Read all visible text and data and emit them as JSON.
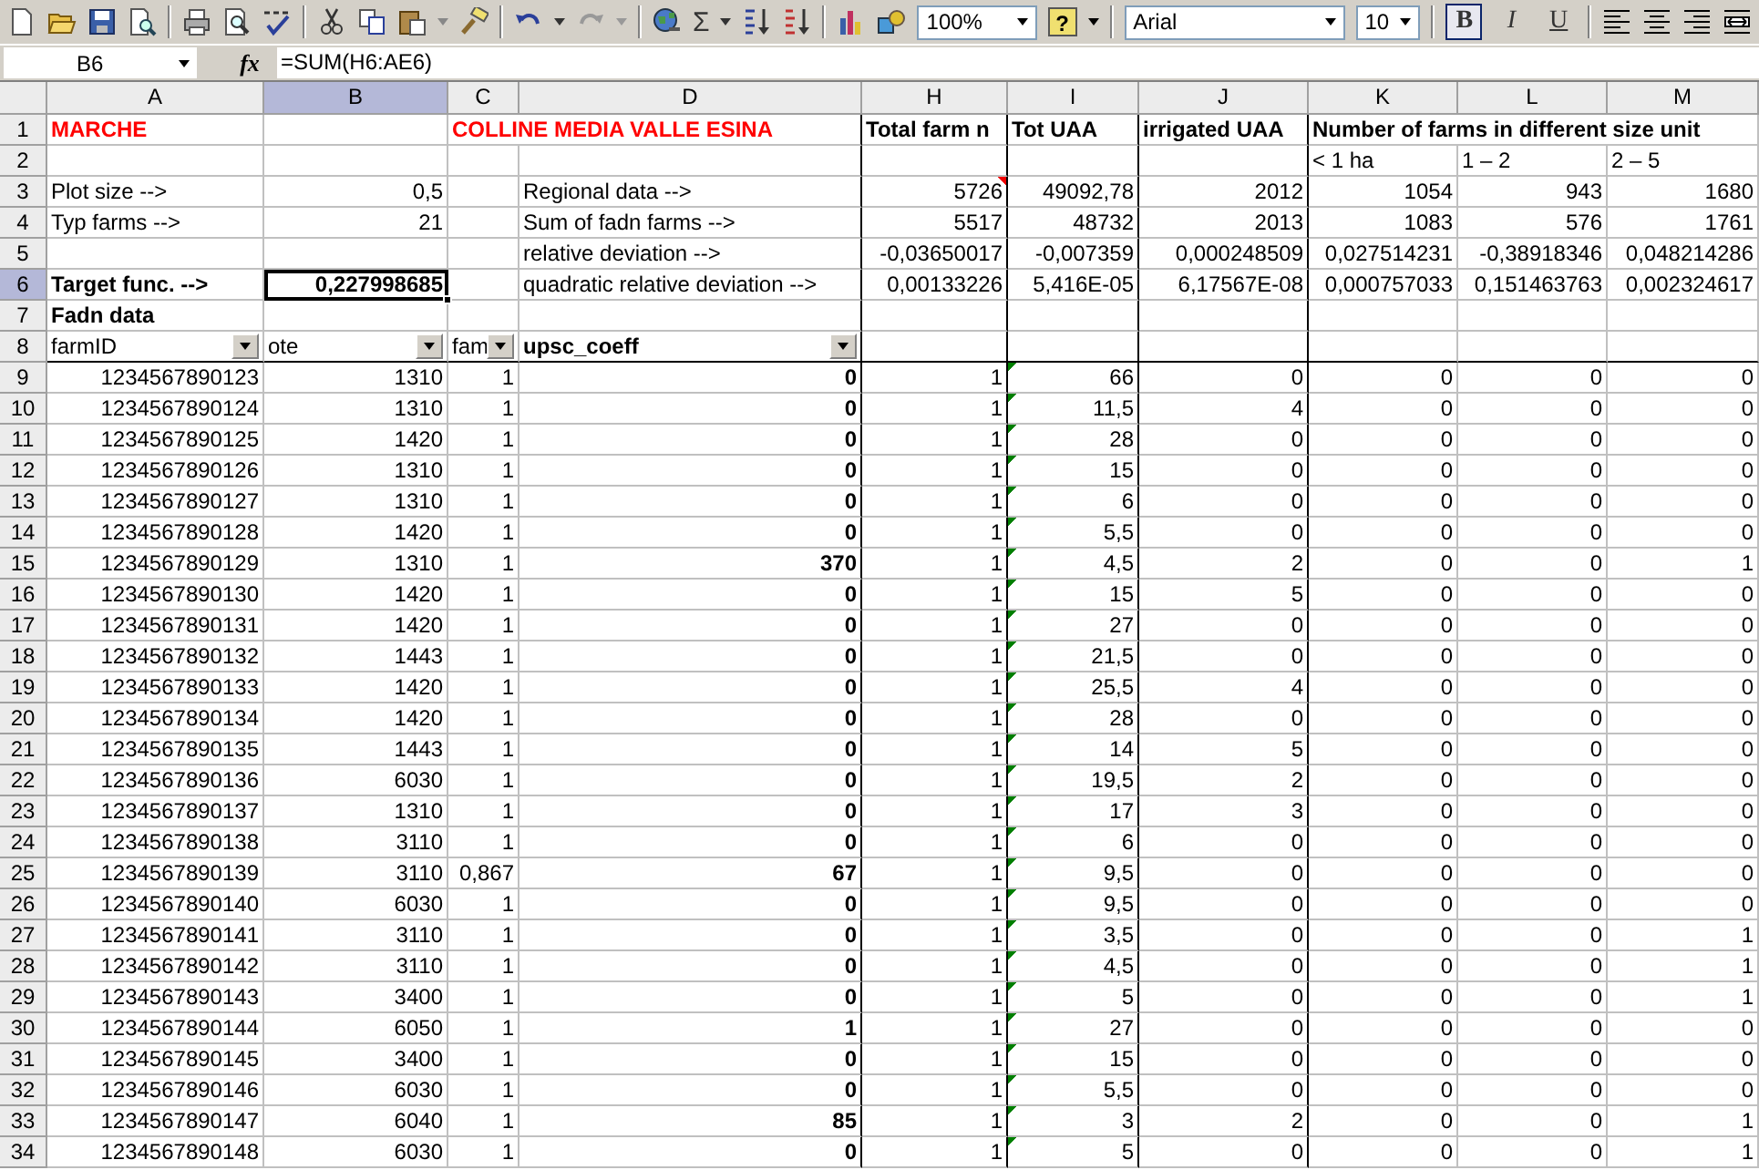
{
  "toolbar": {
    "sum_symbol": "Σ",
    "zoom": "100%",
    "help_symbol": "?",
    "font": "Arial",
    "size": "10",
    "style_buttons": [
      {
        "label": "B",
        "selected": true
      },
      {
        "label": "I",
        "selected": false
      },
      {
        "label": "U",
        "selected": false
      }
    ]
  },
  "formula_bar": {
    "name_box": "B6",
    "fx": "fx",
    "formula": "=SUM(H6:AE6)"
  },
  "columns": [
    {
      "letter": "A",
      "selected": false
    },
    {
      "letter": "B",
      "selected": true
    },
    {
      "letter": "C",
      "selected": false
    },
    {
      "letter": "D",
      "selected": false
    },
    {
      "letter": "H",
      "selected": false
    },
    {
      "letter": "I",
      "selected": false,
      "flagged": true
    },
    {
      "letter": "J",
      "selected": false
    },
    {
      "letter": "K",
      "selected": false
    },
    {
      "letter": "L",
      "selected": false
    },
    {
      "letter": "M",
      "selected": false
    }
  ],
  "rows": [
    {
      "number": "1",
      "selected": false,
      "kind": "form",
      "cells": [
        {
          "kind": "title",
          "text": "MARCHE"
        },
        {
          "kind": "empty"
        },
        {
          "kind": "title-overflow",
          "text": "COLLINE MEDIA VALLE ESINA"
        },
        {
          "kind": "empty"
        },
        {
          "kind": "heading",
          "text": "Total farm n"
        },
        {
          "kind": "heading",
          "text": "Tot UAA"
        },
        {
          "kind": "heading",
          "text": "irrigated UAA"
        },
        {
          "kind": "heading-overflow",
          "text": "Number of farms in different size unit"
        },
        {
          "kind": "empty"
        },
        {
          "kind": "empty"
        }
      ]
    },
    {
      "number": "2",
      "selected": false,
      "kind": "form",
      "cells": [
        {
          "kind": "empty"
        },
        {
          "kind": "empty"
        },
        {
          "kind": "empty"
        },
        {
          "kind": "empty"
        },
        {
          "kind": "empty"
        },
        {
          "kind": "empty"
        },
        {
          "kind": "empty"
        },
        {
          "kind": "label",
          "text": "< 1 ha"
        },
        {
          "kind": "label",
          "text": "1 – 2"
        },
        {
          "kind": "label",
          "text": "2 – 5"
        }
      ]
    },
    {
      "number": "3",
      "selected": false,
      "kind": "form",
      "cells": [
        {
          "kind": "label",
          "text": "Plot size -->"
        },
        {
          "kind": "number",
          "text": "0,5"
        },
        {
          "kind": "empty"
        },
        {
          "kind": "label",
          "text": "Regional data -->"
        },
        {
          "kind": "number",
          "text": "5726",
          "comment": true
        },
        {
          "kind": "number",
          "text": "49092,78"
        },
        {
          "kind": "number",
          "text": "2012"
        },
        {
          "kind": "number",
          "text": "1054"
        },
        {
          "kind": "number",
          "text": "943"
        },
        {
          "kind": "number",
          "text": "1680"
        }
      ]
    },
    {
      "number": "4",
      "selected": false,
      "kind": "form",
      "cells": [
        {
          "kind": "label",
          "text": "Typ farms -->"
        },
        {
          "kind": "number",
          "text": "21"
        },
        {
          "kind": "empty"
        },
        {
          "kind": "label",
          "text": "Sum of fadn farms -->"
        },
        {
          "kind": "number",
          "text": "5517"
        },
        {
          "kind": "number",
          "text": "48732"
        },
        {
          "kind": "number",
          "text": "2013"
        },
        {
          "kind": "number",
          "text": "1083"
        },
        {
          "kind": "number",
          "text": "576"
        },
        {
          "kind": "number",
          "text": "1761"
        }
      ]
    },
    {
      "number": "5",
      "selected": false,
      "kind": "form",
      "cells": [
        {
          "kind": "empty"
        },
        {
          "kind": "empty"
        },
        {
          "kind": "empty"
        },
        {
          "kind": "label",
          "text": "relative deviation  -->"
        },
        {
          "kind": "number",
          "text": "-0,03650017"
        },
        {
          "kind": "number",
          "text": "-0,007359"
        },
        {
          "kind": "number",
          "text": "0,000248509"
        },
        {
          "kind": "number",
          "text": "0,027514231"
        },
        {
          "kind": "number",
          "text": "-0,38918346"
        },
        {
          "kind": "number",
          "text": "0,048214286"
        }
      ]
    },
    {
      "number": "6",
      "selected": true,
      "kind": "form",
      "cells": [
        {
          "kind": "bold",
          "text": "Target func. -->"
        },
        {
          "kind": "bold-number",
          "text": "0,227998685",
          "selected": true
        },
        {
          "kind": "empty"
        },
        {
          "kind": "label",
          "text": "quadratic relative deviation -->"
        },
        {
          "kind": "number",
          "text": "0,00133226"
        },
        {
          "kind": "number",
          "text": "5,416E-05"
        },
        {
          "kind": "number",
          "text": "6,17567E-08"
        },
        {
          "kind": "number",
          "text": "0,000757033"
        },
        {
          "kind": "number",
          "text": "0,151463763"
        },
        {
          "kind": "number",
          "text": "0,002324617"
        }
      ]
    },
    {
      "number": "7",
      "selected": false,
      "kind": "form",
      "cells": [
        {
          "kind": "bold",
          "text": "Fadn data"
        },
        {
          "kind": "empty"
        },
        {
          "kind": "empty"
        },
        {
          "kind": "empty"
        },
        {
          "kind": "empty"
        },
        {
          "kind": "empty"
        },
        {
          "kind": "empty"
        },
        {
          "kind": "empty"
        },
        {
          "kind": "empty"
        },
        {
          "kind": "empty"
        }
      ]
    },
    {
      "number": "8",
      "selected": false,
      "kind": "header",
      "cells": [
        {
          "kind": "filter",
          "text": "farmID"
        },
        {
          "kind": "filter",
          "text": "ote"
        },
        {
          "kind": "filter",
          "text": "fam"
        },
        {
          "kind": "filter-bold",
          "text": "upsc_coeff"
        },
        {
          "kind": "empty"
        },
        {
          "kind": "empty"
        },
        {
          "kind": "empty"
        },
        {
          "kind": "empty"
        },
        {
          "kind": "empty"
        },
        {
          "kind": "empty"
        }
      ]
    },
    {
      "number": "9",
      "selected": false,
      "kind": "data",
      "cells": [
        "1234567890123",
        "1310",
        "1",
        "0",
        "1",
        "66",
        "0",
        "0",
        "0",
        "0"
      ]
    },
    {
      "number": "10",
      "selected": false,
      "kind": "data",
      "cells": [
        "1234567890124",
        "1310",
        "1",
        "0",
        "1",
        "11,5",
        "4",
        "0",
        "0",
        "0"
      ]
    },
    {
      "number": "11",
      "selected": false,
      "kind": "data",
      "cells": [
        "1234567890125",
        "1420",
        "1",
        "0",
        "1",
        "28",
        "0",
        "0",
        "0",
        "0"
      ]
    },
    {
      "number": "12",
      "selected": false,
      "kind": "data",
      "cells": [
        "1234567890126",
        "1310",
        "1",
        "0",
        "1",
        "15",
        "0",
        "0",
        "0",
        "0"
      ]
    },
    {
      "number": "13",
      "selected": false,
      "kind": "data",
      "cells": [
        "1234567890127",
        "1310",
        "1",
        "0",
        "1",
        "6",
        "0",
        "0",
        "0",
        "0"
      ]
    },
    {
      "number": "14",
      "selected": false,
      "kind": "data",
      "cells": [
        "1234567890128",
        "1420",
        "1",
        "0",
        "1",
        "5,5",
        "0",
        "0",
        "0",
        "0"
      ]
    },
    {
      "number": "15",
      "selected": false,
      "kind": "data",
      "cells": [
        "1234567890129",
        "1310",
        "1",
        "370",
        "1",
        "4,5",
        "2",
        "0",
        "0",
        "1"
      ]
    },
    {
      "number": "16",
      "selected": false,
      "kind": "data",
      "cells": [
        "1234567890130",
        "1420",
        "1",
        "0",
        "1",
        "15",
        "5",
        "0",
        "0",
        "0"
      ]
    },
    {
      "number": "17",
      "selected": false,
      "kind": "data",
      "cells": [
        "1234567890131",
        "1420",
        "1",
        "0",
        "1",
        "27",
        "0",
        "0",
        "0",
        "0"
      ]
    },
    {
      "number": "18",
      "selected": false,
      "kind": "data",
      "cells": [
        "1234567890132",
        "1443",
        "1",
        "0",
        "1",
        "21,5",
        "0",
        "0",
        "0",
        "0"
      ]
    },
    {
      "number": "19",
      "selected": false,
      "kind": "data",
      "cells": [
        "1234567890133",
        "1420",
        "1",
        "0",
        "1",
        "25,5",
        "4",
        "0",
        "0",
        "0"
      ]
    },
    {
      "number": "20",
      "selected": false,
      "kind": "data",
      "cells": [
        "1234567890134",
        "1420",
        "1",
        "0",
        "1",
        "28",
        "0",
        "0",
        "0",
        "0"
      ]
    },
    {
      "number": "21",
      "selected": false,
      "kind": "data",
      "cells": [
        "1234567890135",
        "1443",
        "1",
        "0",
        "1",
        "14",
        "5",
        "0",
        "0",
        "0"
      ]
    },
    {
      "number": "22",
      "selected": false,
      "kind": "data",
      "cells": [
        "1234567890136",
        "6030",
        "1",
        "0",
        "1",
        "19,5",
        "2",
        "0",
        "0",
        "0"
      ]
    },
    {
      "number": "23",
      "selected": false,
      "kind": "data",
      "cells": [
        "1234567890137",
        "1310",
        "1",
        "0",
        "1",
        "17",
        "3",
        "0",
        "0",
        "0"
      ]
    },
    {
      "number": "24",
      "selected": false,
      "kind": "data",
      "cells": [
        "1234567890138",
        "3110",
        "1",
        "0",
        "1",
        "6",
        "0",
        "0",
        "0",
        "0"
      ]
    },
    {
      "number": "25",
      "selected": false,
      "kind": "data",
      "cells": [
        "1234567890139",
        "3110",
        "0,867",
        "67",
        "1",
        "9,5",
        "0",
        "0",
        "0",
        "0"
      ]
    },
    {
      "number": "26",
      "selected": false,
      "kind": "data",
      "cells": [
        "1234567890140",
        "6030",
        "1",
        "0",
        "1",
        "9,5",
        "0",
        "0",
        "0",
        "0"
      ]
    },
    {
      "number": "27",
      "selected": false,
      "kind": "data",
      "cells": [
        "1234567890141",
        "3110",
        "1",
        "0",
        "1",
        "3,5",
        "0",
        "0",
        "0",
        "1"
      ]
    },
    {
      "number": "28",
      "selected": false,
      "kind": "data",
      "cells": [
        "1234567890142",
        "3110",
        "1",
        "0",
        "1",
        "4,5",
        "0",
        "0",
        "0",
        "1"
      ]
    },
    {
      "number": "29",
      "selected": false,
      "kind": "data",
      "cells": [
        "1234567890143",
        "3400",
        "1",
        "0",
        "1",
        "5",
        "0",
        "0",
        "0",
        "1"
      ]
    },
    {
      "number": "30",
      "selected": false,
      "kind": "data",
      "cells": [
        "1234567890144",
        "6050",
        "1",
        "1",
        "1",
        "27",
        "0",
        "0",
        "0",
        "0"
      ]
    },
    {
      "number": "31",
      "selected": false,
      "kind": "data",
      "cells": [
        "1234567890145",
        "3400",
        "1",
        "0",
        "1",
        "15",
        "0",
        "0",
        "0",
        "0"
      ]
    },
    {
      "number": "32",
      "selected": false,
      "kind": "data",
      "cells": [
        "1234567890146",
        "6030",
        "1",
        "0",
        "1",
        "5,5",
        "0",
        "0",
        "0",
        "0"
      ]
    },
    {
      "number": "33",
      "selected": false,
      "kind": "data",
      "cells": [
        "1234567890147",
        "6040",
        "1",
        "85",
        "1",
        "3",
        "2",
        "0",
        "0",
        "1"
      ]
    },
    {
      "number": "34",
      "selected": false,
      "kind": "data",
      "cells": [
        "1234567890148",
        "6030",
        "1",
        "0",
        "1",
        "5",
        "0",
        "0",
        "0",
        "1"
      ]
    }
  ]
}
